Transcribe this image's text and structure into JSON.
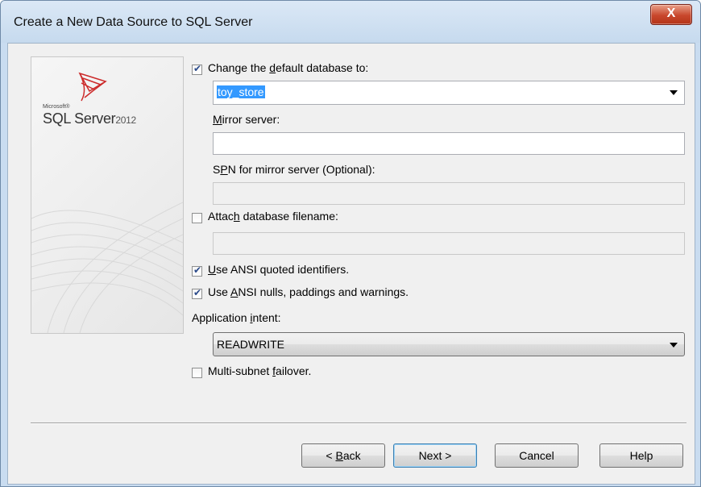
{
  "window": {
    "title": "Create a New Data Source to SQL Server",
    "close_label": "X"
  },
  "logo": {
    "microsoft": "Microsoft®",
    "product": "SQL Server",
    "year": "2012"
  },
  "change_default_db": {
    "label_pre": "Change the ",
    "label_key": "d",
    "label_post": "efault database to:",
    "checked": true,
    "value": "toy_store"
  },
  "mirror_server": {
    "label_key": "M",
    "label_post": "irror server:",
    "value": ""
  },
  "spn": {
    "label_pre": "S",
    "label_key": "P",
    "label_post": "N for mirror server (Optional):",
    "value": ""
  },
  "attach_db": {
    "label_pre": "Attac",
    "label_key": "h",
    "label_post": " database filename:",
    "checked": false,
    "value": ""
  },
  "ansi_quoted": {
    "label_key": "U",
    "label_post": "se ANSI quoted identifiers.",
    "checked": true
  },
  "ansi_nulls": {
    "label_pre": "Use ",
    "label_key": "A",
    "label_post": "NSI nulls, paddings and warnings.",
    "checked": true
  },
  "app_intent": {
    "label_pre": "Application ",
    "label_key": "i",
    "label_post": "ntent:",
    "value": "READWRITE"
  },
  "multi_subnet": {
    "label_pre": "Multi-subnet ",
    "label_key": "f",
    "label_post": "ailover.",
    "checked": false
  },
  "buttons": {
    "back_pre": "< ",
    "back_key": "B",
    "back_post": "ack",
    "next": "Next >",
    "cancel": "Cancel",
    "help": "Help"
  }
}
